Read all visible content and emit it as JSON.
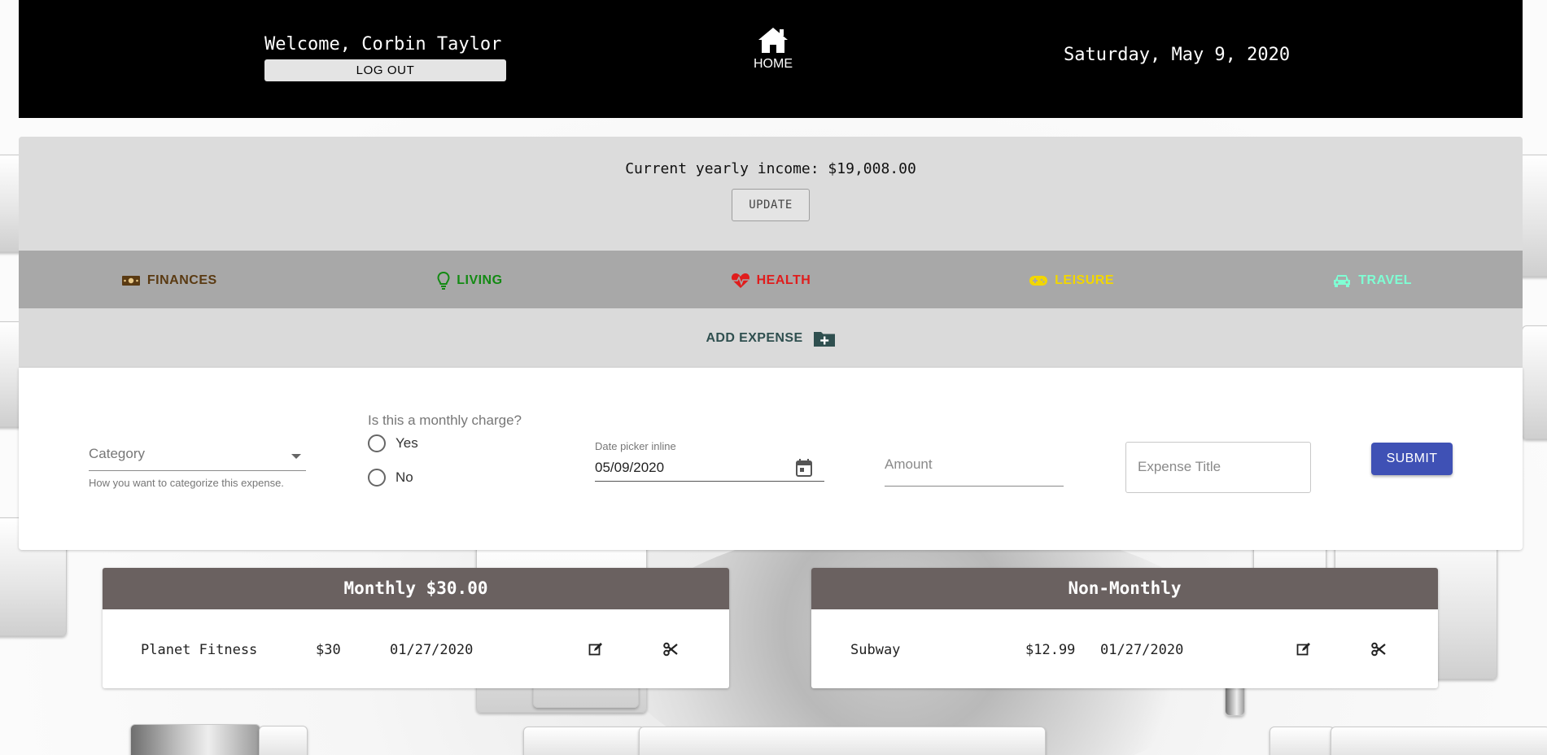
{
  "header": {
    "welcome": "Welcome, Corbin Taylor",
    "logout_label": "LOG OUT",
    "home_label": "HOME",
    "date": "Saturday, May 9, 2020"
  },
  "income": {
    "text": "Current yearly income: $19,008.00",
    "update_label": "UPDATE"
  },
  "tabs": [
    {
      "label": "FINANCES",
      "icon": "money-icon",
      "color": "#5a3a12"
    },
    {
      "label": "LIVING",
      "icon": "lightbulb-icon",
      "color": "#138a13"
    },
    {
      "label": "HEALTH",
      "icon": "heartbeat-icon",
      "color": "#e01c1c"
    },
    {
      "label": "LEISURE",
      "icon": "gamepad-icon",
      "color": "#f2d600"
    },
    {
      "label": "TRAVEL",
      "icon": "car-icon",
      "color": "#7fffd4"
    }
  ],
  "add_expense": {
    "label": "ADD EXPENSE",
    "icon": "folder-plus-icon"
  },
  "form": {
    "category_placeholder": "Category",
    "category_help": "How you want to categorize this expense.",
    "monthly_question": "Is this a monthly charge?",
    "yes_label": "Yes",
    "no_label": "No",
    "date_label": "Date picker inline",
    "date_value": "05/09/2020",
    "amount_placeholder": "Amount",
    "title_placeholder": "Expense Title",
    "submit_label": "SUBMIT",
    "accent": "#3f51b5"
  },
  "monthly": {
    "title": "Monthly $30.00",
    "items": [
      {
        "name": "Planet Fitness",
        "amount": "$30",
        "date": "01/27/2020"
      }
    ]
  },
  "non_monthly": {
    "title": "Non-Monthly",
    "items": [
      {
        "name": "Subway",
        "amount": "$12.99",
        "date": "01/27/2020"
      }
    ]
  }
}
